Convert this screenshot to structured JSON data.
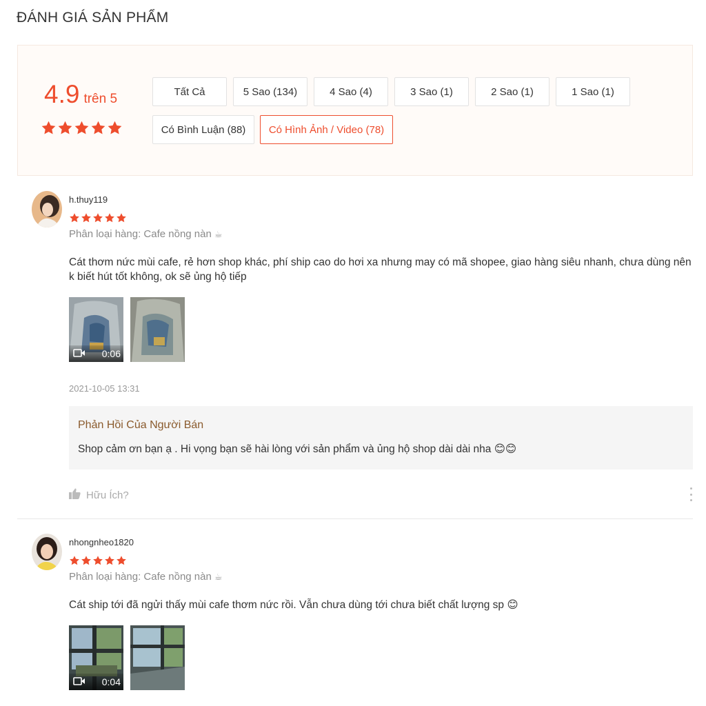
{
  "page_title": "ĐÁNH GIÁ SẢN PHẨM",
  "summary": {
    "score": "4.9",
    "out_of": "trên 5",
    "stars": 5
  },
  "filters": [
    {
      "label": "Tất Cả",
      "active": false
    },
    {
      "label": "5 Sao (134)",
      "active": false
    },
    {
      "label": "4 Sao (4)",
      "active": false
    },
    {
      "label": "3 Sao (1)",
      "active": false
    },
    {
      "label": "2 Sao (1)",
      "active": false
    },
    {
      "label": "1 Sao (1)",
      "active": false
    },
    {
      "label": "Có Bình Luận (88)",
      "active": false
    },
    {
      "label": "Có Hình Ảnh / Video (78)",
      "active": true
    }
  ],
  "reviews": [
    {
      "username": "h.thuy119",
      "stars": 5,
      "variation": "Phân loại hàng: Cafe nồng nàn",
      "comment": "Cát thơm nức mùi cafe, rẻ hơn shop khác, phí ship cao do hơi xa nhưng may có mã shopee, giao hàng siêu nhanh, chưa dùng nên k biết hút tốt không, ok sẽ ủng hộ tiếp",
      "media": [
        {
          "type": "video",
          "duration": "0:06"
        },
        {
          "type": "image"
        }
      ],
      "timestamp": "2021-10-05 13:31",
      "seller_reply": {
        "title": "Phản Hồi Của Người Bán",
        "text": "Shop cảm ơn bạn ạ . Hi vọng bạn sẽ hài lòng với sản phẩm và ủng hộ shop dài dài nha 😊😊"
      },
      "helpful_label": "Hữu Ích?"
    },
    {
      "username": "nhongnheo1820",
      "stars": 5,
      "variation": "Phân loại hàng: Cafe nồng nàn",
      "comment": "Cát ship tới đã ngửi thấy mùi cafe thơm nức rồi. Vẫn chưa dùng tới chưa biết chất lượng sp 😊",
      "media": [
        {
          "type": "video",
          "duration": "0:04"
        },
        {
          "type": "image"
        }
      ]
    }
  ],
  "colors": {
    "accent": "#ee4d2d",
    "overview_bg": "#fffbf8",
    "reply_bg": "#f5f5f5",
    "reply_title": "#8a5a2c"
  }
}
